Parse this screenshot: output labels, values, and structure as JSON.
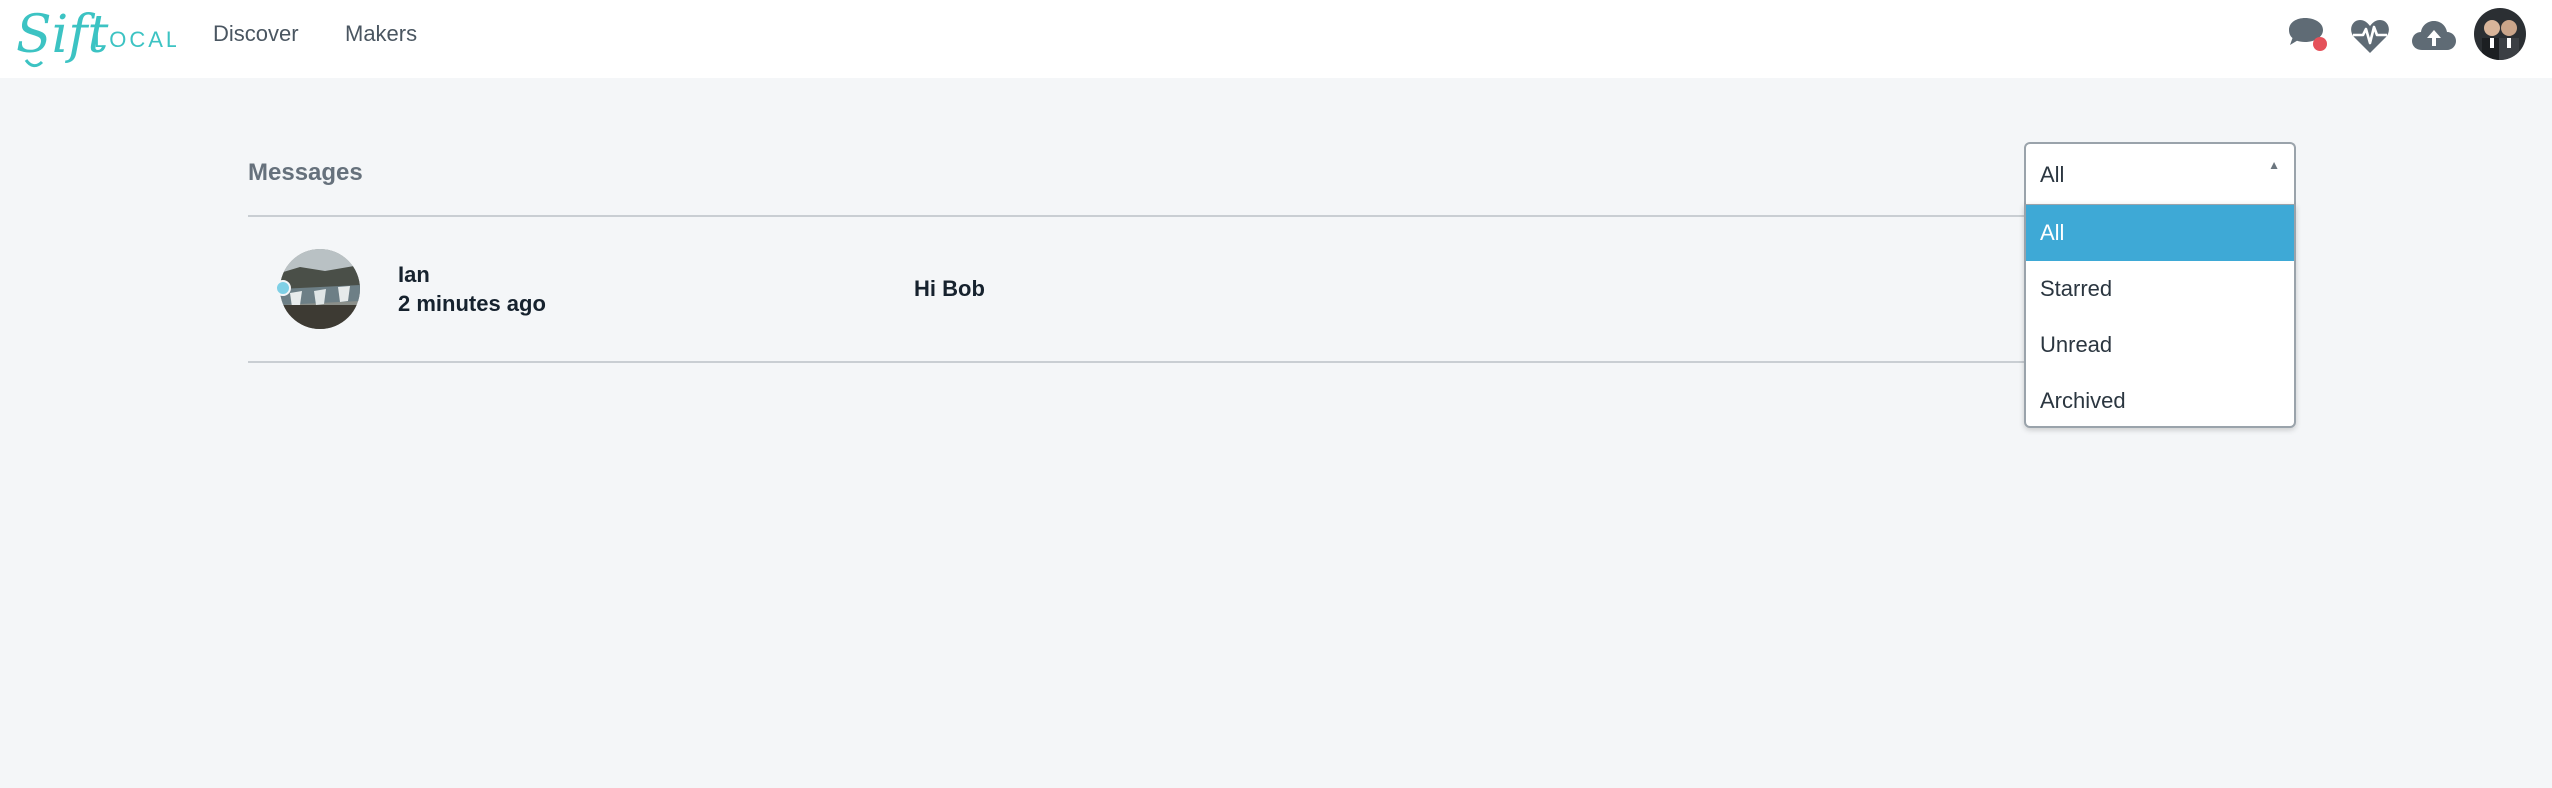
{
  "brand": {
    "script_word": "Sift",
    "caps_word": "LOCAL",
    "color": "#3cc3c3"
  },
  "nav": {
    "links": [
      {
        "label": "Discover"
      },
      {
        "label": "Makers"
      }
    ],
    "icons": [
      "chat-icon",
      "heart-pulse-icon",
      "cloud-upload-icon"
    ],
    "notification_color": "#e5515a"
  },
  "messages": {
    "title": "Messages",
    "threads": [
      {
        "name": "Ian",
        "time": "2 minutes ago",
        "preview": "Hi Bob",
        "unread": true
      }
    ]
  },
  "filter": {
    "selected": "All",
    "options": [
      "All",
      "Starred",
      "Unread",
      "Archived"
    ],
    "highlight_color": "#3ea9d6"
  }
}
